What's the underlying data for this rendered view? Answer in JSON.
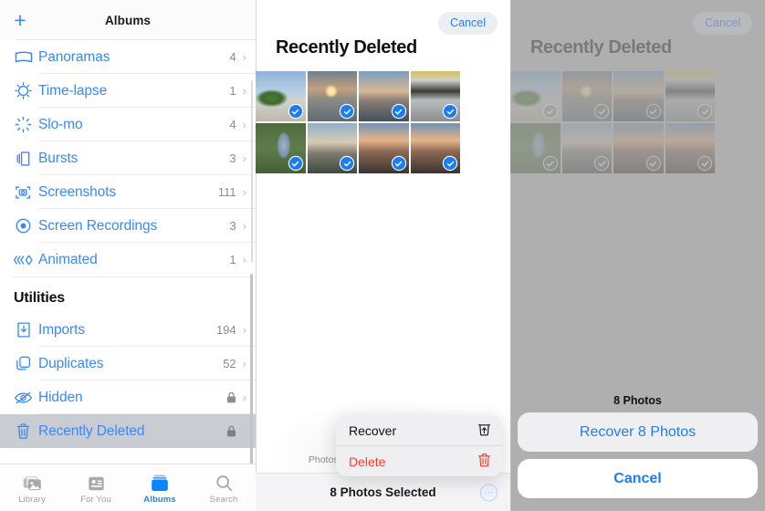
{
  "sidebar": {
    "header": {
      "title": "Albums",
      "add_label": "+"
    },
    "albums": [
      {
        "label": "Panoramas",
        "count": "4",
        "icon": "panorama-icon"
      },
      {
        "label": "Time-lapse",
        "count": "1",
        "icon": "timelapse-icon"
      },
      {
        "label": "Slo-mo",
        "count": "4",
        "icon": "slomo-icon"
      },
      {
        "label": "Bursts",
        "count": "3",
        "icon": "bursts-icon"
      },
      {
        "label": "Screenshots",
        "count": "111",
        "icon": "screenshots-icon"
      },
      {
        "label": "Screen Recordings",
        "count": "3",
        "icon": "screen-recordings-icon"
      },
      {
        "label": "Animated",
        "count": "1",
        "icon": "animated-icon"
      }
    ],
    "section_title": "Utilities",
    "utilities": [
      {
        "label": "Imports",
        "count": "194",
        "locked": false,
        "icon": "imports-icon"
      },
      {
        "label": "Duplicates",
        "count": "52",
        "locked": false,
        "icon": "duplicates-icon"
      },
      {
        "label": "Hidden",
        "count": "",
        "locked": true,
        "icon": "hidden-icon"
      },
      {
        "label": "Recently Deleted",
        "count": "",
        "locked": true,
        "icon": "trash-icon",
        "selected": true
      }
    ]
  },
  "tabbar": {
    "tabs": [
      {
        "label": "Library",
        "icon": "library-icon",
        "active": false
      },
      {
        "label": "For You",
        "icon": "for-you-icon",
        "active": false
      },
      {
        "label": "Albums",
        "icon": "albums-icon",
        "active": true
      },
      {
        "label": "Search",
        "icon": "search-icon",
        "active": false
      }
    ]
  },
  "middle_panel": {
    "cancel_label": "Cancel",
    "title": "Recently Deleted",
    "photos": [
      {
        "alt": "beach-tree",
        "selected": true
      },
      {
        "alt": "sunset-sea",
        "selected": true
      },
      {
        "alt": "city-skyline",
        "selected": true
      },
      {
        "alt": "silver-car",
        "selected": true
      },
      {
        "alt": "hand-can",
        "selected": true
      },
      {
        "alt": "city-sunrise",
        "selected": true
      },
      {
        "alt": "rooftop-sunset",
        "selected": true
      },
      {
        "alt": "rooftop-dusk",
        "selected": true
      }
    ],
    "info_text": "Photos and vi deletion. After tha Th",
    "selection_label": "8 Photos Selected",
    "more_label": "···",
    "context_menu": [
      {
        "label": "Recover",
        "icon": "recover-trash-icon",
        "danger": false
      },
      {
        "label": "Delete",
        "icon": "delete-trash-icon",
        "danger": true
      }
    ]
  },
  "right_panel": {
    "cancel_label": "Cancel",
    "title": "Recently Deleted",
    "sheet_title": "8 Photos",
    "recover_label": "Recover 8 Photos",
    "cancel_button_label": "Cancel"
  },
  "colors": {
    "accent_blue": "#3a88fd",
    "danger_red": "#ff3b30",
    "selected_row": "#c9ccd3",
    "checkmark_blue": "#1a7df5"
  }
}
